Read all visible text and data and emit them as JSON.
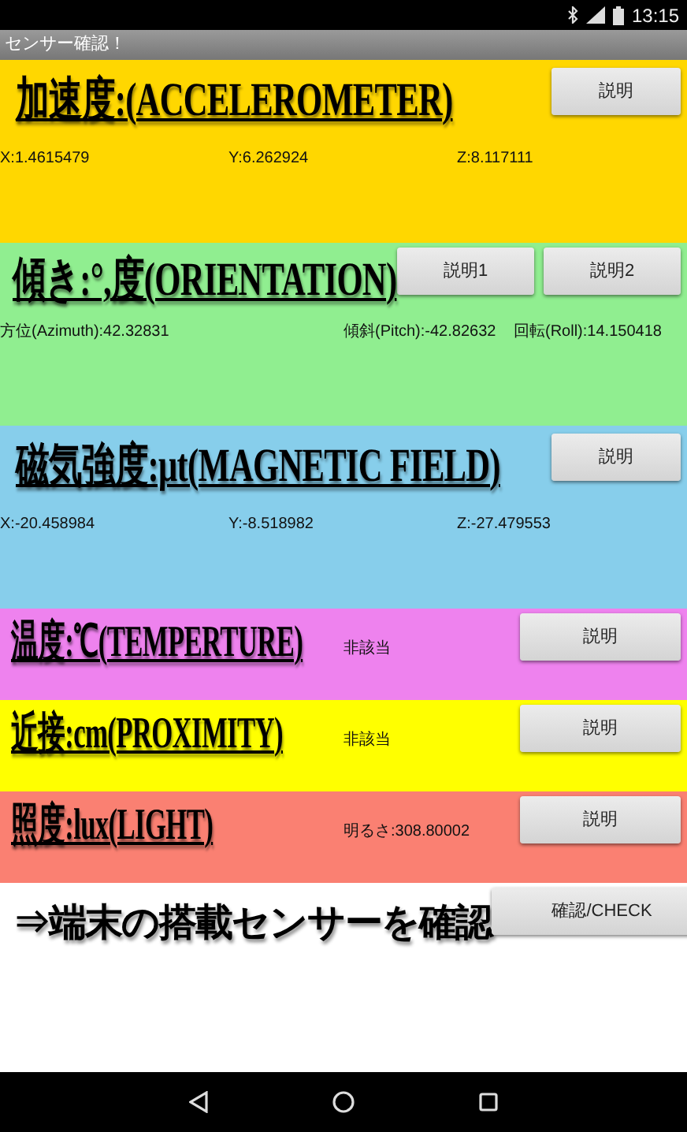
{
  "status_bar": {
    "time": "13:15"
  },
  "app_bar": {
    "title": "センサー確認！"
  },
  "sections": [
    {
      "kind": "vector",
      "color": "#ffd700",
      "title": "加速度:(ACCELEROMETER)",
      "buttons": [
        "説明"
      ],
      "readings": [
        "X:1.4615479",
        "Y:6.262924",
        "Z:8.117111"
      ]
    },
    {
      "kind": "orientation",
      "color": "#90ee90",
      "title": "傾き:°,度(ORIENTATION)",
      "buttons": [
        "説明1",
        "説明2"
      ],
      "readings": [
        "方位(Azimuth):42.32831",
        "傾斜(Pitch):-42.82632",
        "回転(Roll):14.150418"
      ]
    },
    {
      "kind": "vector",
      "color": "#87ceeb",
      "title": "磁気強度:μt(MAGNETIC FIELD)",
      "buttons": [
        "説明"
      ],
      "readings": [
        "X:-20.458984",
        "Y:-8.518982",
        "Z:-27.479553"
      ]
    },
    {
      "kind": "scalar",
      "color": "#ee82ee",
      "title": "温度:℃(TEMPERTURE)",
      "buttons": [
        "説明"
      ],
      "readings": [
        "非該当"
      ]
    },
    {
      "kind": "scalar",
      "color": "#ffff00",
      "title": "近接:cm(PROXIMITY)",
      "buttons": [
        "説明"
      ],
      "readings": [
        "非該当"
      ]
    },
    {
      "kind": "scalar",
      "color": "#fa8072",
      "title": "照度:lux(LIGHT)",
      "buttons": [
        "説明"
      ],
      "readings": [
        "明るさ:308.80002"
      ]
    }
  ],
  "check": {
    "title": "⇒端末の搭載センサーを確認",
    "button": "確認/CHECK"
  }
}
